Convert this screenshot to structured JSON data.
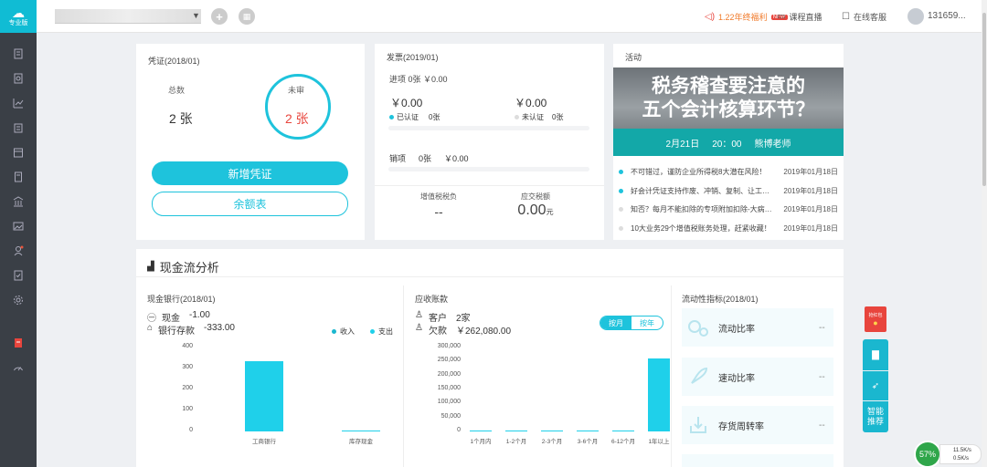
{
  "sidebar": {
    "logo_label": "专业版"
  },
  "topbar": {
    "company_name": "",
    "notice": "1.22年终福利",
    "course": "课程直播",
    "service": "在线客服",
    "user": "131659..."
  },
  "voucher": {
    "title": "凭证(2018/01)",
    "total_label": "总数",
    "total_value": "2 张",
    "unreviewed_label": "未审",
    "unreviewed_value": "2 张",
    "add_button": "新增凭证",
    "balance_button": "余额表"
  },
  "invoice": {
    "title": "发票(2019/01)",
    "input_label": "进项 0张 ￥0.00",
    "left_amount": "￥0.00",
    "right_amount": "￥0.00",
    "certified": "已认证",
    "certified_count": "0张",
    "uncertified": "未认证",
    "uncertified_count": "0张",
    "output_label": "销项",
    "output_count": "0张",
    "output_amount": "￥0.00",
    "vat_label": "增值税税负",
    "vat_value": "--",
    "tax_label": "应交税额",
    "tax_value": "0.00",
    "tax_unit": "元"
  },
  "activity": {
    "title": "活动",
    "banner_line1": "税务稽查要注意的",
    "banner_line2": "五个会计核算环节？",
    "banner_date": "2月21日",
    "banner_time": "20：00",
    "banner_teacher": "熊博老师",
    "news": [
      {
        "text": "不可错过，谨防企业所得税8大潜在风险！",
        "date": "2019年01月18日"
      },
      {
        "text": "好会计凭证支持作废、冲销、复制、让工…",
        "date": "2019年01月18日"
      },
      {
        "text": "知否？每月不能扣除的专项附加扣除-大病…",
        "date": "2019年01月18日"
      },
      {
        "text": "10大业务29个增值税账务处理，赶紧收藏！",
        "date": "2019年01月18日"
      }
    ]
  },
  "cashflow": {
    "section_title": "现金流分析",
    "bank_title": "现金银行(2018/01)",
    "cash_label": "现金",
    "cash_value": "-1.00",
    "bank_label": "银行存款",
    "bank_value": "-333.00",
    "legend_income": "收入",
    "legend_expense": "支出",
    "recv_title": "应收账款",
    "customer_label": "客户",
    "customer_value": "2家",
    "owed_label": "欠款",
    "owed_value": "￥262,080.00",
    "tab_month": "按月",
    "tab_year": "按年",
    "liq_title": "流动性指标(2018/01)",
    "ratios": [
      {
        "label": "流动比率",
        "value": "--"
      },
      {
        "label": "速动比率",
        "value": "--"
      },
      {
        "label": "存货周转率",
        "value": "--"
      }
    ]
  },
  "float": {
    "redpack": "抢红包",
    "smart": "智能推荐"
  },
  "netspeed": {
    "percent": "57%",
    "up": "11.5K/s",
    "down": "0.5K/s"
  },
  "chart_data": [
    {
      "type": "bar",
      "categories": [
        "工商银行",
        "库存现金"
      ],
      "values": [
        333,
        1
      ],
      "yticks": [
        "400",
        "300",
        "200",
        "100",
        "0"
      ],
      "ylim": [
        0,
        400
      ],
      "color": "#1fd0ea"
    },
    {
      "type": "bar",
      "categories": [
        "1个月内",
        "1-2个月",
        "2-3个月",
        "3-6个月",
        "6-12个月",
        "1年以上"
      ],
      "values": [
        0,
        0,
        0,
        0,
        0,
        262080
      ],
      "yticks": [
        "300,000",
        "250,000",
        "200,000",
        "150,000",
        "100,000",
        "50,000",
        "0"
      ],
      "ylim": [
        0,
        300000
      ],
      "color": "#1fd0ea"
    }
  ]
}
